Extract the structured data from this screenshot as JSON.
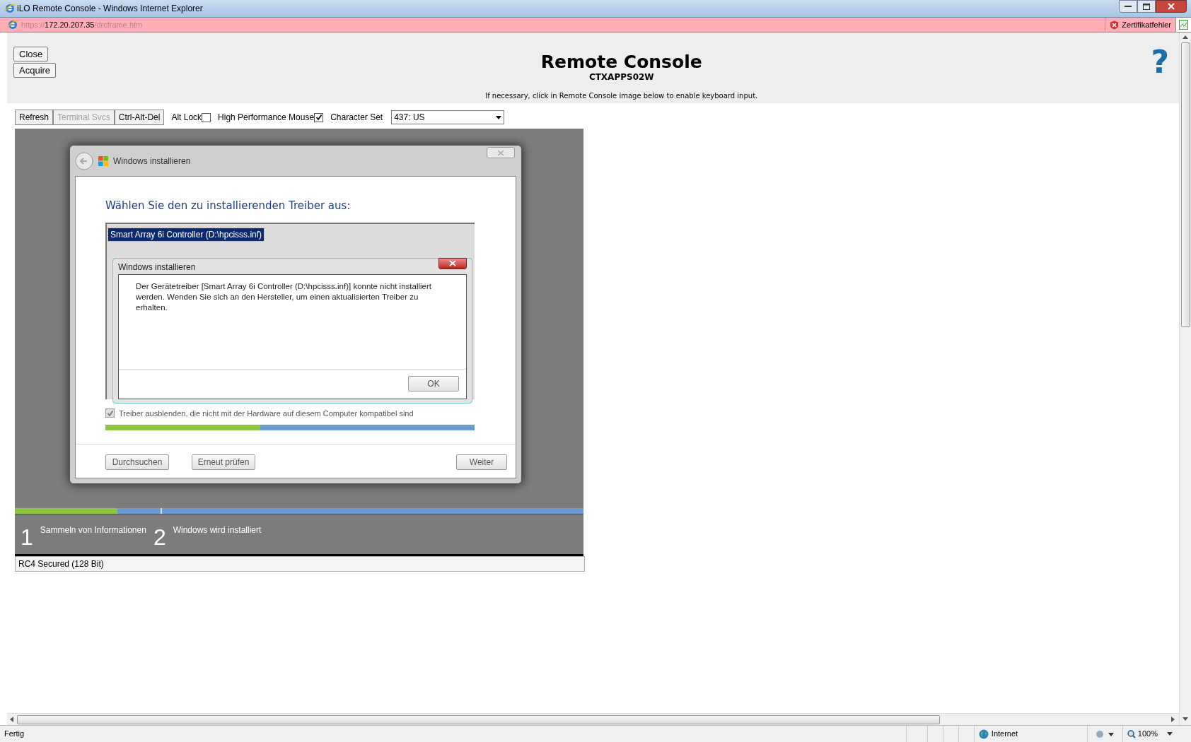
{
  "window": {
    "title": "iLO Remote Console - Windows Internet Explorer"
  },
  "address_bar": {
    "scheme": "https://",
    "host": "172.20.207.35",
    "path": "/drcframe.htm",
    "certificate_error": "Zertifikatfehler"
  },
  "header": {
    "buttons": [
      "Close",
      "Acquire"
    ],
    "title": "Remote Console",
    "host_name": "CTXAPPS02W",
    "hint": "If necessary, click in Remote Console image below to enable keyboard input.",
    "help": "?"
  },
  "toolbar": {
    "items": [
      {
        "kind": "button",
        "label": "Refresh",
        "disabled": false
      },
      {
        "kind": "button",
        "label": "Terminal Svcs",
        "disabled": true
      },
      {
        "kind": "button",
        "label": "Ctrl-Alt-Del",
        "disabled": false
      },
      {
        "kind": "checkbox",
        "label": "Alt Lock",
        "checked": false
      },
      {
        "kind": "checkbox",
        "label": "High Performance Mouse",
        "checked": true
      },
      {
        "kind": "select",
        "label": "Character Set",
        "value": "437: US"
      }
    ]
  },
  "console": {
    "setup_window": {
      "title": "Windows installieren",
      "heading": "Wählen Sie den zu installierenden Treiber aus:",
      "drivers": [
        {
          "label": "Smart Array 6i Controller (D:\\hpcisss.inf)",
          "selected": true
        }
      ],
      "error_dialog": {
        "title": "Windows installieren",
        "message": "Der Gerätetreiber [Smart Array 6i Controller (D:\\hpcisss.inf)] konnte nicht installiert werden. Wenden Sie sich an den Hersteller, um einen aktualisierten Treiber zu erhalten.",
        "button": "OK"
      },
      "hide_incompatible": {
        "label": "Treiber ausblenden, die nicht mit der Hardware auf diesem Computer kompatibel sind",
        "checked": true
      },
      "progress": {
        "level": 0.42
      },
      "buttons": [
        "Durchsuchen",
        "Erneut prüfen",
        "Weiter"
      ]
    },
    "install_progress": {
      "level": 0.18
    },
    "steps": [
      {
        "number": "1",
        "label": "Sammeln von Informationen"
      },
      {
        "number": "2",
        "label": "Windows wird installiert"
      }
    ]
  },
  "console_status": "RC4 Secured (128 Bit)",
  "status_bar": {
    "text": "Fertig",
    "zone": "Internet",
    "zoom": "100%"
  }
}
